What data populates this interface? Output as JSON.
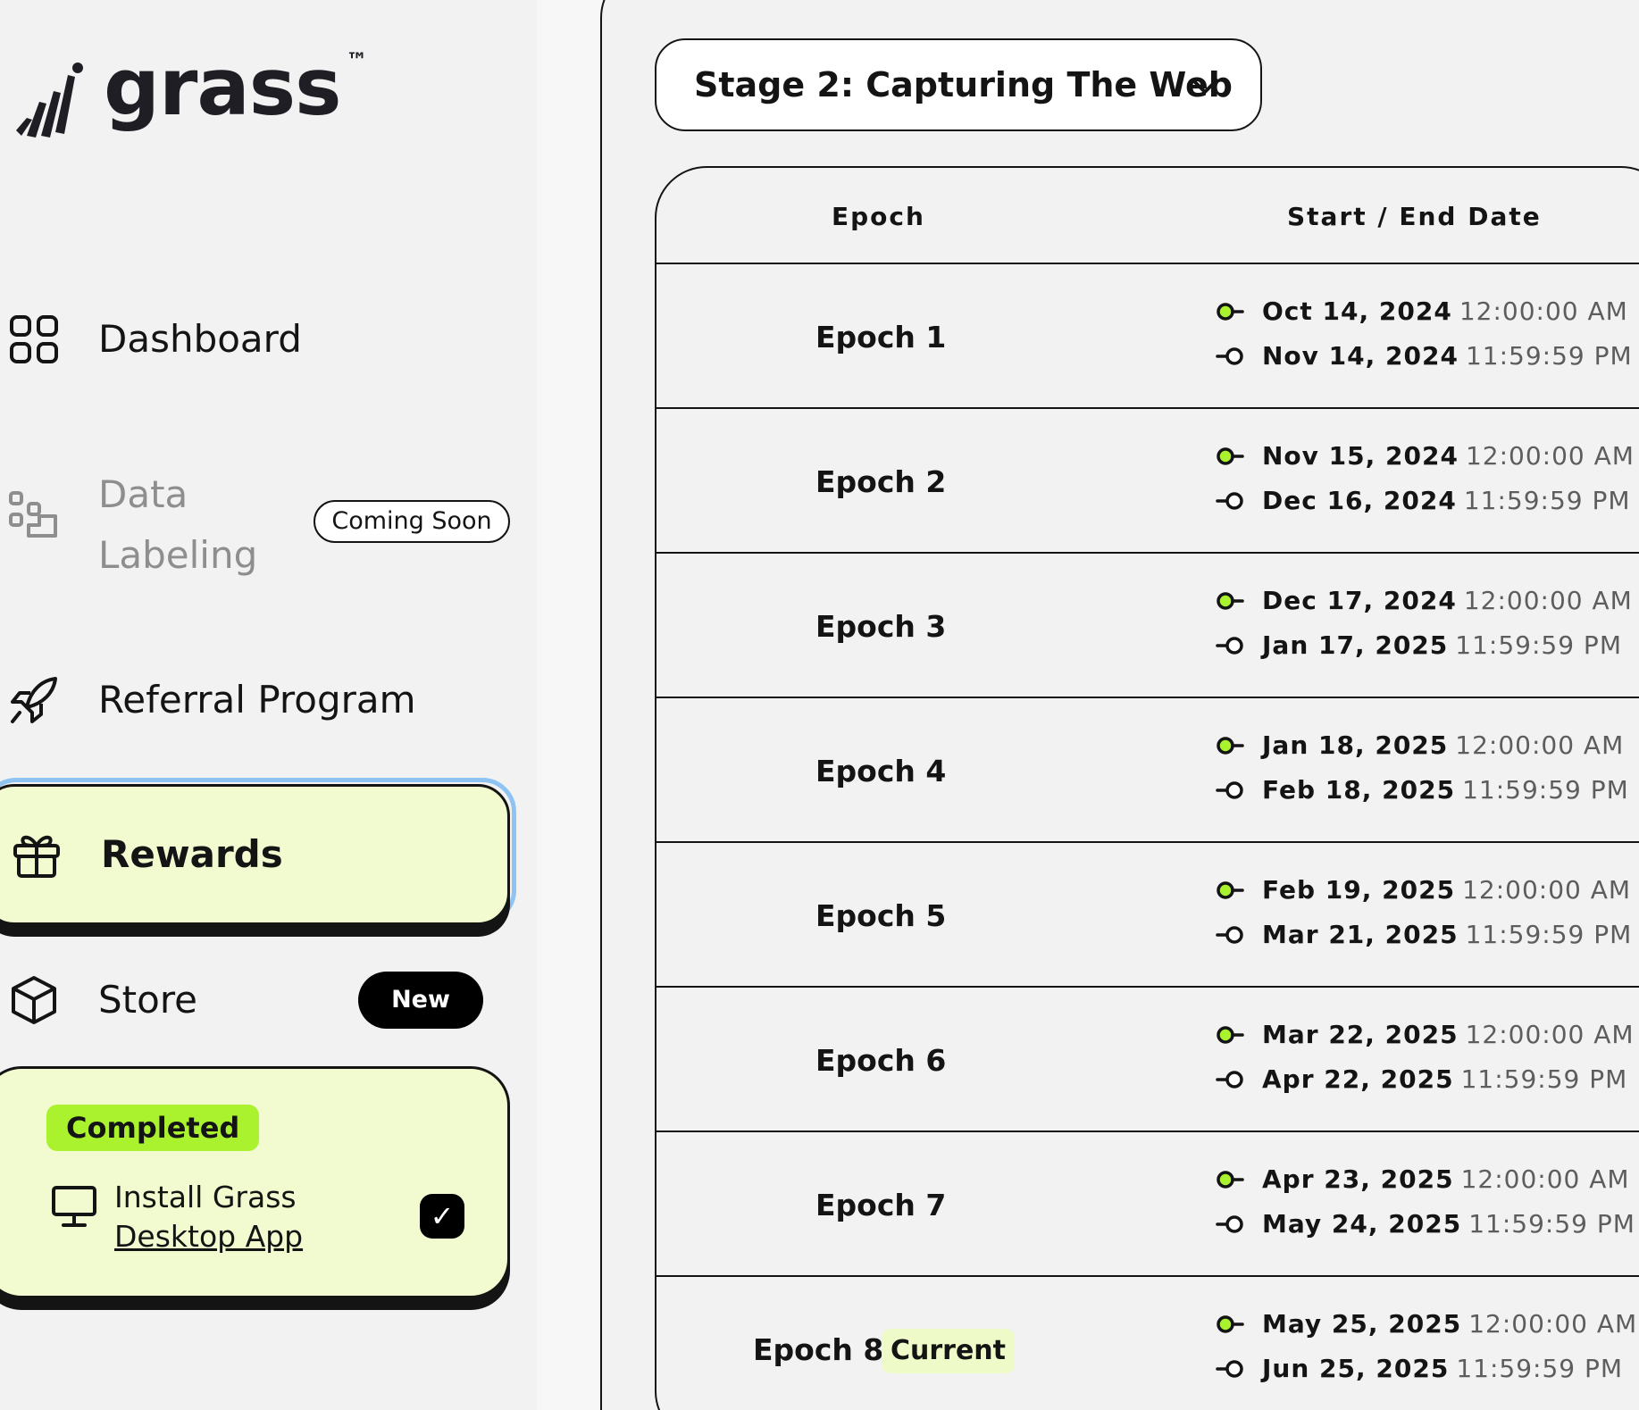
{
  "brand": {
    "name": "grass",
    "tm": "™"
  },
  "sidebar": {
    "items": [
      {
        "label": "Dashboard",
        "icon": "grid-icon"
      },
      {
        "label": "Data Labeling",
        "icon": "data-labeling-icon",
        "badge": "Coming Soon"
      },
      {
        "label": "Referral Program",
        "icon": "rocket-icon"
      },
      {
        "label": "Rewards",
        "icon": "gift-icon",
        "active": true
      },
      {
        "label": "Store",
        "icon": "box-icon",
        "badge": "New"
      }
    ],
    "task_card": {
      "status": "Completed",
      "line1": "Install Grass",
      "line2": "Desktop App",
      "check": "✓"
    }
  },
  "main": {
    "stage_select": {
      "value": "Stage 2: Capturing The Web"
    },
    "table": {
      "headers": {
        "epoch": "Epoch",
        "date": "Start / End Date"
      },
      "rows": [
        {
          "epoch": "Epoch 1",
          "start_date": "Oct 14, 2024",
          "start_time": "12:00:00 AM",
          "end_date": "Nov 14, 2024",
          "end_time": "11:59:59 PM"
        },
        {
          "epoch": "Epoch 2",
          "start_date": "Nov 15, 2024",
          "start_time": "12:00:00 AM",
          "end_date": "Dec 16, 2024",
          "end_time": "11:59:59 PM"
        },
        {
          "epoch": "Epoch 3",
          "start_date": "Dec 17, 2024",
          "start_time": "12:00:00 AM",
          "end_date": "Jan 17, 2025",
          "end_time": "11:59:59 PM"
        },
        {
          "epoch": "Epoch 4",
          "start_date": "Jan 18, 2025",
          "start_time": "12:00:00 AM",
          "end_date": "Feb 18, 2025",
          "end_time": "11:59:59 PM"
        },
        {
          "epoch": "Epoch 5",
          "start_date": "Feb 19, 2025",
          "start_time": "12:00:00 AM",
          "end_date": "Mar 21, 2025",
          "end_time": "11:59:59 PM"
        },
        {
          "epoch": "Epoch 6",
          "start_date": "Mar 22, 2025",
          "start_time": "12:00:00 AM",
          "end_date": "Apr 22, 2025",
          "end_time": "11:59:59 PM"
        },
        {
          "epoch": "Epoch 7",
          "start_date": "Apr 23, 2025",
          "start_time": "12:00:00 AM",
          "end_date": "May 24, 2025",
          "end_time": "11:59:59 PM"
        },
        {
          "epoch": "Epoch 8",
          "badge": "Current",
          "start_date": "May 25, 2025",
          "start_time": "12:00:00 AM",
          "end_date": "Jun 25, 2025",
          "end_time": "11:59:59 PM"
        }
      ]
    }
  },
  "colors": {
    "accent_green": "#aaf22e",
    "active_bg": "#f1fbcf",
    "focus_ring": "#8fc3f2",
    "start_dot": "#aaf22e"
  }
}
